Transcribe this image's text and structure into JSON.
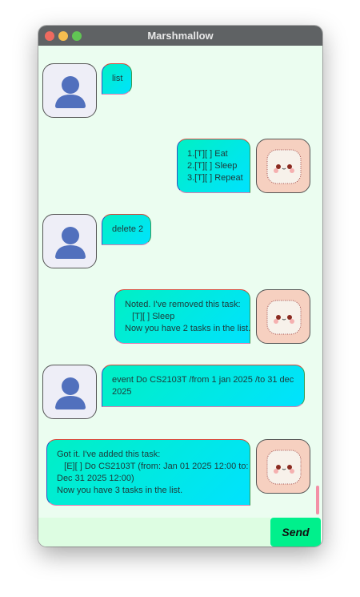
{
  "window": {
    "title": "Marshmallow",
    "controls": {
      "close": "#ee6a5f",
      "minimize": "#f5bd4f",
      "maximize": "#61c554"
    }
  },
  "messages": [
    {
      "sender": "user",
      "text": "list"
    },
    {
      "sender": "bot",
      "text": "1.[T][ ] Eat\n2.[T][ ] Sleep\n3.[T][ ] Repeat"
    },
    {
      "sender": "user",
      "text": "delete 2"
    },
    {
      "sender": "bot",
      "text": "Noted. I've removed this task:\n   [T][ ] Sleep\nNow you have 2 tasks in the list."
    },
    {
      "sender": "user",
      "text": "event Do CS2103T /from 1 jan 2025 /to 31 dec\n2025"
    },
    {
      "sender": "bot",
      "text": "Got it. I've added this task:\n   [E][ ] Do CS2103T (from: Jan 01 2025 12:00 to:\nDec 31 2025 12:00)\nNow you have 3 tasks in the list."
    }
  ],
  "input": {
    "value": "",
    "placeholder": ""
  },
  "send_label": "Send",
  "colors": {
    "bubble_start": "#00f0c4",
    "bubble_end": "#00e2ff",
    "background": "#ebfdf0",
    "send": "#00f08c"
  }
}
